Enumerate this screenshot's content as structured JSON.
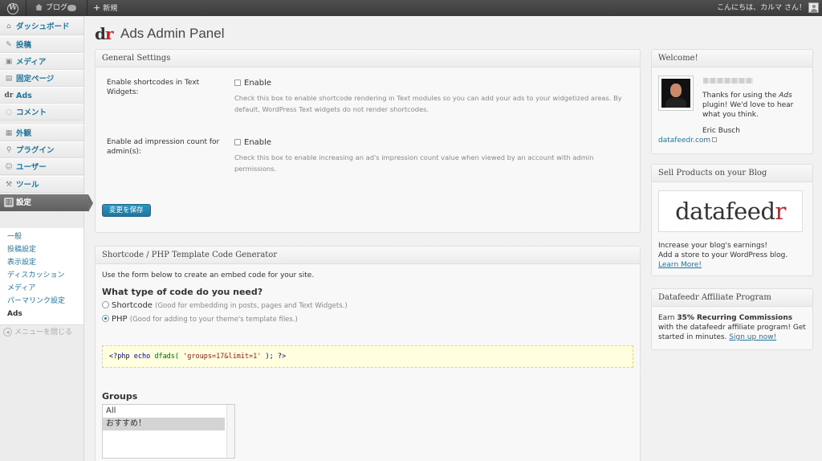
{
  "adminbar": {
    "site_name": "ブログ",
    "new_label": "新規",
    "greeting": "こんにちは、カルマ さん！"
  },
  "menu": {
    "items": [
      {
        "label": "ダッシュボード",
        "icon": "dashboard-icon"
      },
      {
        "label": "投稿",
        "icon": "pin-icon"
      },
      {
        "label": "メディア",
        "icon": "media-icon"
      },
      {
        "label": "固定ページ",
        "icon": "page-icon"
      },
      {
        "label": "Ads",
        "icon": "dr-icon"
      },
      {
        "label": "コメント",
        "icon": "comment-icon"
      },
      {
        "label": "外観",
        "icon": "appearance-icon"
      },
      {
        "label": "プラグイン",
        "icon": "plugin-icon"
      },
      {
        "label": "ユーザー",
        "icon": "users-icon"
      },
      {
        "label": "ツール",
        "icon": "tools-icon"
      },
      {
        "label": "設定",
        "icon": "settings-icon"
      }
    ],
    "submenu": [
      "一般",
      "投稿設定",
      "表示設定",
      "ディスカッション",
      "メディア",
      "パーマリンク設定",
      "Ads"
    ],
    "collapse_label": "メニューを閉じる"
  },
  "page": {
    "logo_d": "d",
    "logo_r": "r",
    "title": "Ads Admin Panel"
  },
  "general": {
    "title": "General Settings",
    "shortcodes_label": "Enable shortcodes in Text Widgets:",
    "shortcodes_checkbox": "Enable",
    "shortcodes_desc": "Check this box to enable shortcode rendering in Text modules so you can add your ads to your widgetized areas. By default, WordPress Text widgets do not render shortcodes.",
    "impression_label": "Enable ad impression count for admin(s):",
    "impression_checkbox": "Enable",
    "impression_desc": "Check this box to enable increasing an ad's impression count value when viewed by an account with admin permissions.",
    "save_label": "変更を保存"
  },
  "generator": {
    "title": "Shortcode / PHP Template Code Generator",
    "intro": "Use the form below to create an embed code for your site.",
    "question": "What type of code do you need?",
    "opt_shortcode": "Shortcode",
    "opt_shortcode_hint": "(Good for embedding in posts, pages and Text Widgets.)",
    "opt_php": "PHP",
    "opt_php_hint": "(Good for adding to your theme's template files.)",
    "selected": "PHP",
    "code_open": "<?php",
    "code_echo": "echo",
    "code_fn": "dfads(",
    "code_arg": "'groups=17&limit=1'",
    "code_close": "); ?>",
    "groups_label": "Groups",
    "groups": [
      "All",
      "おすすめ！"
    ],
    "groups_selected": "おすすめ！"
  },
  "welcome": {
    "title": "Welcome!",
    "thanks_pre": "Thanks for using the ",
    "thanks_em": "Ads",
    "thanks_post": " plugin! We'd love to hear what you think.",
    "author": "Eric Busch",
    "link": "datafeedr.com"
  },
  "sell": {
    "title": "Sell Products on your Blog",
    "logo_main": "datafeed",
    "logo_r": "r",
    "line1": "Increase your blog's earnings!",
    "line2": "Add a store to your WordPress blog.",
    "link": "Learn More!"
  },
  "affiliate": {
    "title": "Datafeedr Affiliate Program",
    "pre": "Earn ",
    "bold": "35% Recurring Commissions",
    "post": " with the datafeedr affiliate program! Get started in minutes. ",
    "link": "Sign up now!"
  },
  "colors": {
    "link": "#21759b",
    "brand_red": "#c12026",
    "adminbar": "#464646"
  }
}
